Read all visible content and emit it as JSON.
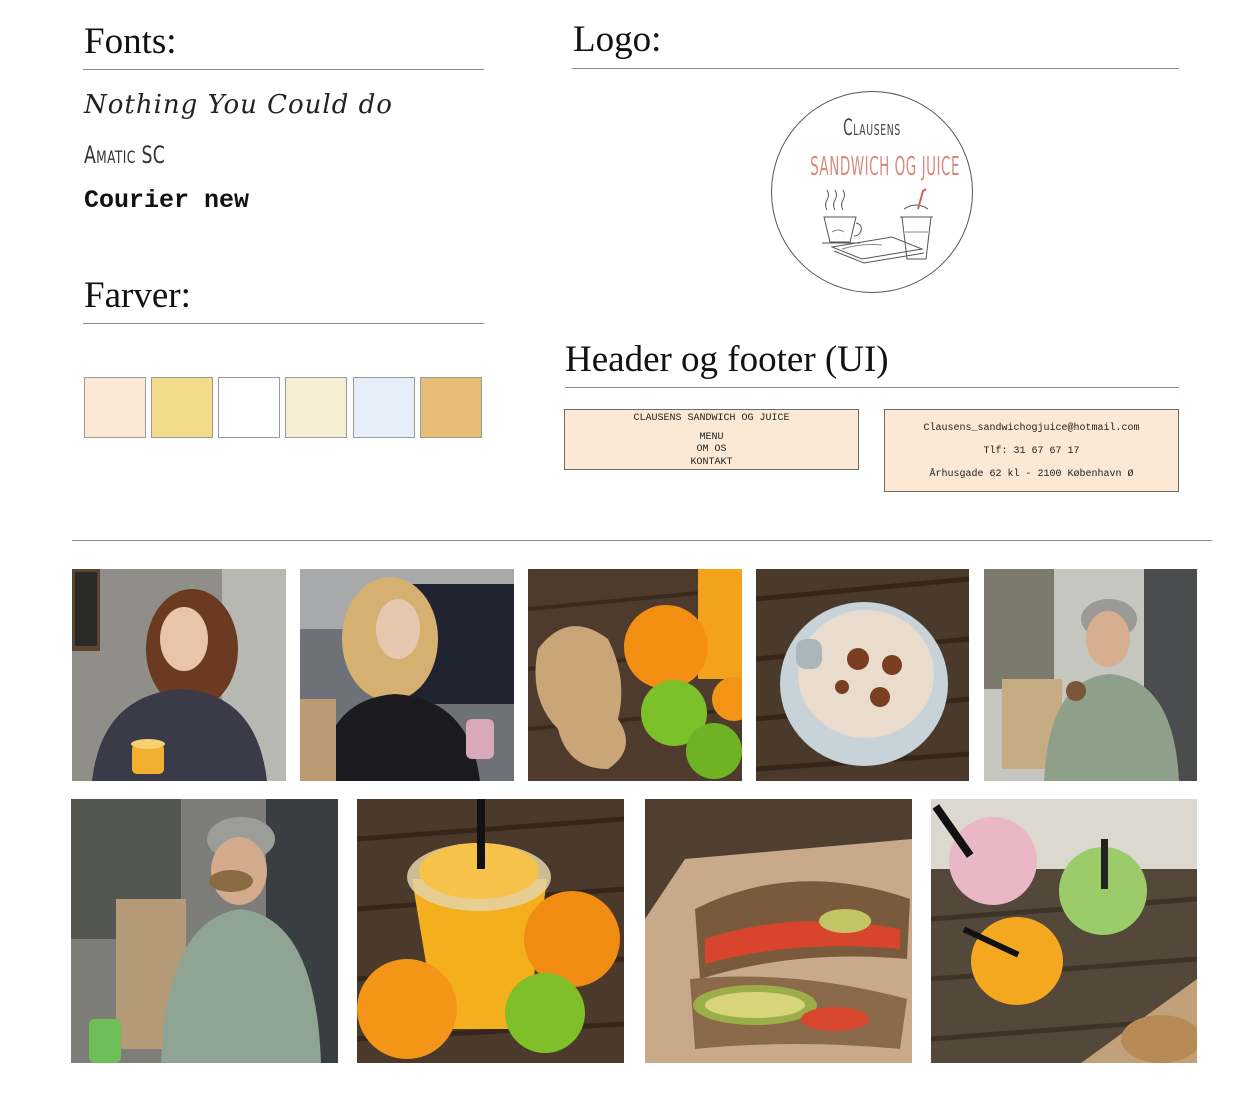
{
  "sections": {
    "fonts_title": "Fonts:",
    "logo_title": "Logo:",
    "colors_title": "Farver:",
    "ui_title": "Header og footer (UI)"
  },
  "fonts": {
    "sample1": "Nothing You Could do",
    "sample2": "Amatic SC",
    "sample3": "Courier new"
  },
  "colors": [
    "#fbe9d5",
    "#f2dc8c",
    "#ffffff",
    "#f7efd4",
    "#e6eff9",
    "#e8bd78"
  ],
  "logo": {
    "line1": "Clausens",
    "line2": "SANDWICH OG JUICE"
  },
  "header_box": {
    "title": "CLAUSENS SANDWICH OG JUICE",
    "menu": [
      "MENU",
      "OM OS",
      "KONTAKT"
    ]
  },
  "footer_box": {
    "email": "Clausens_sandwichogjuice@hotmail.com",
    "phone": "Tlf: 31 67 67 17",
    "address": "Århusgade 62 kl - 2100 København Ø"
  },
  "photos": [
    "smiling-woman-with-juice",
    "woman-with-smoothie",
    "ginger-oranges-limes",
    "cappuccino",
    "woman-laughing",
    "woman-eating-sandwich",
    "orange-juice-with-fruit",
    "sandwich-with-avocado",
    "smoothies-on-table"
  ]
}
